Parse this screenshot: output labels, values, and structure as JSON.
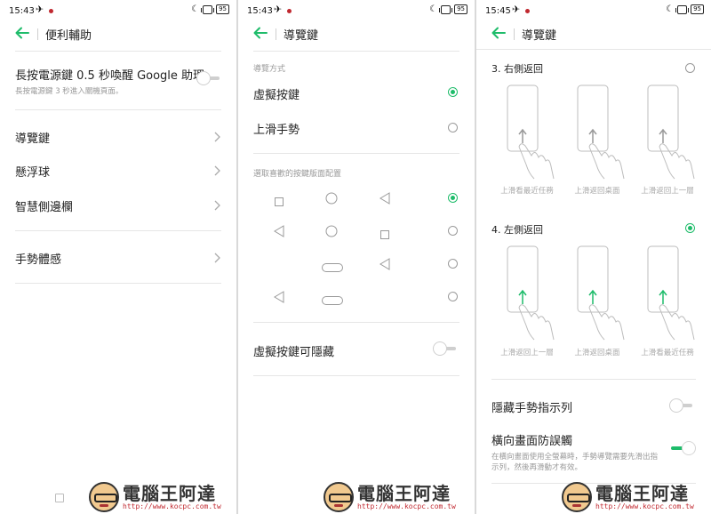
{
  "status_p1": {
    "time": "15:43",
    "battery": "95"
  },
  "status_p2": {
    "time": "15:43",
    "battery": "95"
  },
  "status_p3": {
    "time": "15:45",
    "battery": "95"
  },
  "panel1": {
    "title": "便利輔助",
    "power_title": "長按電源鍵 0.5 秒喚醒 Google 助理",
    "power_sub": "長按電源鍵 3 秒進入關機頁面。",
    "items": [
      "導覽鍵",
      "懸浮球",
      "智慧側邊欄"
    ],
    "gesture_item": "手勢體感"
  },
  "panel2": {
    "title": "導覽鍵",
    "method_label": "導覽方式",
    "virtual_label": "虛擬按鍵",
    "swipe_label": "上滑手勢",
    "layout_label": "選取喜歡的按鍵版面配置",
    "hide_label": "虛擬按鍵可隱藏"
  },
  "panel3": {
    "title": "導覽鍵",
    "option3_label": "3. 右側返回",
    "option3_captions": [
      "上滑看最近任務",
      "上滑返回桌面",
      "上滑返回上一層"
    ],
    "option4_label": "4. 左側返回",
    "option4_captions": [
      "上滑返回上一層",
      "上滑返回桌面",
      "上滑看最近任務"
    ],
    "hide_indicator_label": "隱藏手勢指示列",
    "landscape_label": "橫向畫面防誤觸",
    "landscape_sub": "在橫向畫面使用全螢幕時，手勢導覽需要先滑出指示列，然後再滑動才有效。"
  },
  "watermark": {
    "title": "電腦王阿達",
    "url": "http://www.kocpc.com.tw"
  },
  "colors": {
    "accent": "#1ebc6a",
    "status_dot": "#c0282f"
  }
}
